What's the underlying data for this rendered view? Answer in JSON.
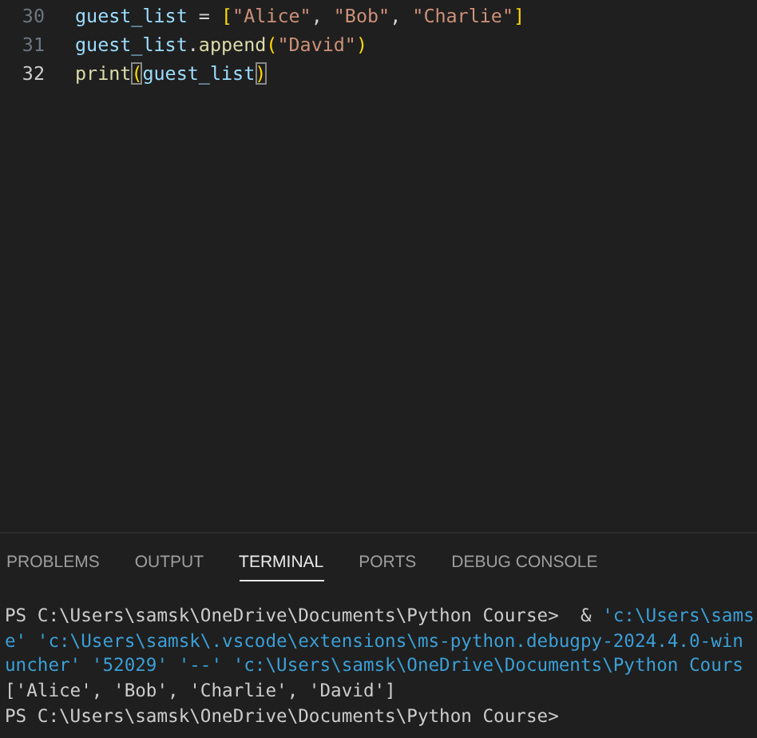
{
  "editor": {
    "lines": [
      {
        "number": "30",
        "active": false,
        "tokens": [
          {
            "text": "guest_list",
            "kind": "var"
          },
          {
            "text": " = ",
            "kind": "op"
          },
          {
            "text": "[",
            "kind": "bracket"
          },
          {
            "text": "\"Alice\"",
            "kind": "str"
          },
          {
            "text": ", ",
            "kind": "op"
          },
          {
            "text": "\"Bob\"",
            "kind": "str"
          },
          {
            "text": ", ",
            "kind": "op"
          },
          {
            "text": "\"Charlie\"",
            "kind": "str"
          },
          {
            "text": "]",
            "kind": "bracket"
          }
        ]
      },
      {
        "number": "31",
        "active": false,
        "tokens": [
          {
            "text": "guest_list",
            "kind": "var"
          },
          {
            "text": ".",
            "kind": "op"
          },
          {
            "text": "append",
            "kind": "fn"
          },
          {
            "text": "(",
            "kind": "bracket"
          },
          {
            "text": "\"David\"",
            "kind": "str"
          },
          {
            "text": ")",
            "kind": "bracket"
          }
        ]
      },
      {
        "number": "32",
        "active": true,
        "tokens": [
          {
            "text": "print",
            "kind": "fn"
          },
          {
            "text": "(",
            "kind": "match"
          },
          {
            "text": "guest_list",
            "kind": "var"
          },
          {
            "text": ")",
            "kind": "match"
          }
        ]
      }
    ]
  },
  "panel": {
    "tabs": [
      {
        "label": "PROBLEMS",
        "selected": false
      },
      {
        "label": "OUTPUT",
        "selected": false
      },
      {
        "label": "TERMINAL",
        "selected": true
      },
      {
        "label": "PORTS",
        "selected": false
      },
      {
        "label": "DEBUG CONSOLE",
        "selected": false
      }
    ],
    "terminal": [
      [
        {
          "text": "PS C:\\Users\\samsk\\OneDrive\\Documents\\Python Course>  & ",
          "kind": "plain"
        },
        {
          "text": "'c:\\Users\\sams",
          "kind": "arg"
        }
      ],
      [
        {
          "text": "e' 'c:\\Users\\samsk\\.vscode\\extensions\\ms-python.debugpy-2024.4.0-win",
          "kind": "arg"
        }
      ],
      [
        {
          "text": "uncher' '52029' '--' 'c:\\Users\\samsk\\OneDrive\\Documents\\Python Cours",
          "kind": "arg"
        }
      ],
      [
        {
          "text": "['Alice', 'Bob', 'Charlie', 'David']",
          "kind": "plain"
        }
      ],
      [
        {
          "text": "PS C:\\Users\\samsk\\OneDrive\\Documents\\Python Course>",
          "kind": "plain"
        }
      ]
    ]
  }
}
